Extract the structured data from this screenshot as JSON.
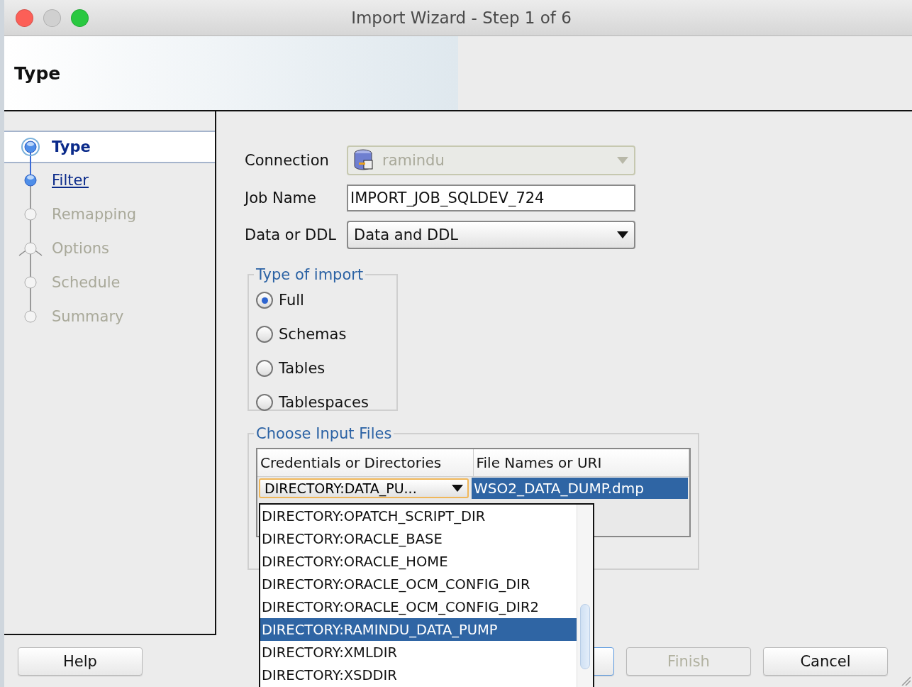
{
  "window": {
    "title": "Import Wizard - Step 1 of 6"
  },
  "header": {
    "title": "Type"
  },
  "steps": [
    {
      "label": "Type",
      "selected": true,
      "disabled": false,
      "branch": false
    },
    {
      "label": "Filter",
      "selected": false,
      "disabled": false,
      "branch": false
    },
    {
      "label": "Remapping",
      "selected": false,
      "disabled": true,
      "branch": false
    },
    {
      "label": "Options",
      "selected": false,
      "disabled": true,
      "branch": true
    },
    {
      "label": "Schedule",
      "selected": false,
      "disabled": true,
      "branch": false
    },
    {
      "label": "Summary",
      "selected": false,
      "disabled": true,
      "branch": false
    }
  ],
  "form": {
    "connection": {
      "label": "Connection",
      "value": "ramindu",
      "disabled": true
    },
    "job_name": {
      "label": "Job Name",
      "value": "IMPORT_JOB_SQLDEV_724"
    },
    "data_or_ddl": {
      "label": "Data or DDL",
      "value": "Data and DDL"
    }
  },
  "type_of_import": {
    "title": "Type of import",
    "options": [
      {
        "label": "Full",
        "selected": true
      },
      {
        "label": "Schemas",
        "selected": false
      },
      {
        "label": "Tables",
        "selected": false
      },
      {
        "label": "Tablespaces",
        "selected": false
      }
    ]
  },
  "input_files": {
    "title": "Choose Input Files",
    "columns": [
      "Credentials or Directories",
      "File Names or URI"
    ],
    "rows": [
      {
        "directory": "DIRECTORY:DATA_PU...",
        "file": "WSO2_DATA_DUMP.dmp",
        "selected": true
      }
    ]
  },
  "directory_dropdown": {
    "items": [
      {
        "label": "DIRECTORY:OPATCH_SCRIPT_DIR",
        "selected": false
      },
      {
        "label": "DIRECTORY:ORACLE_BASE",
        "selected": false
      },
      {
        "label": "DIRECTORY:ORACLE_HOME",
        "selected": false
      },
      {
        "label": "DIRECTORY:ORACLE_OCM_CONFIG_DIR",
        "selected": false
      },
      {
        "label": "DIRECTORY:ORACLE_OCM_CONFIG_DIR2",
        "selected": false
      },
      {
        "label": "DIRECTORY:RAMINDU_DATA_PUMP",
        "selected": true
      },
      {
        "label": "DIRECTORY:XMLDIR",
        "selected": false
      },
      {
        "label": "DIRECTORY:XSDDIR",
        "selected": false
      }
    ]
  },
  "buttons": [
    {
      "label": "Help",
      "kind": "help",
      "disabled": false
    },
    {
      "label": "Finish",
      "kind": "finish",
      "disabled": true
    },
    {
      "label": "Cancel",
      "kind": "cancel",
      "disabled": false
    }
  ]
}
